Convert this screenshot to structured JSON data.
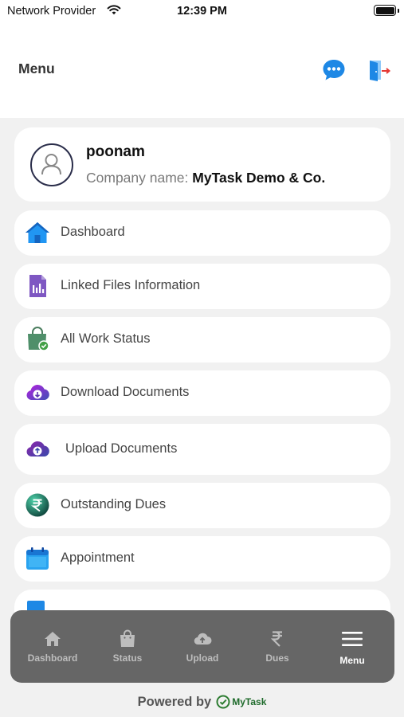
{
  "status_bar": {
    "carrier": "Network Provider",
    "time": "12:39 PM"
  },
  "header": {
    "title": "Menu",
    "chat_icon": "chat-bubble-icon",
    "logout_icon": "logout-door-icon"
  },
  "profile": {
    "name": "poonam",
    "company_label": "Company name:",
    "company_value": "MyTask Demo & Co."
  },
  "menu": {
    "items": [
      {
        "label": "Dashboard",
        "icon": "home-icon"
      },
      {
        "label": "Linked Files Information",
        "icon": "file-chart-icon"
      },
      {
        "label": "All Work Status",
        "icon": "bag-check-icon"
      },
      {
        "label": "Download Documents",
        "icon": "cloud-download-icon"
      },
      {
        "label": "Upload Documents",
        "icon": "cloud-upload-icon"
      },
      {
        "label": "Outstanding Dues",
        "icon": "rupee-coin-icon"
      },
      {
        "label": "Appointment",
        "icon": "calendar-icon"
      }
    ]
  },
  "bottom_nav": {
    "items": [
      {
        "label": "Dashboard",
        "icon": "home-icon"
      },
      {
        "label": "Status",
        "icon": "bag-icon"
      },
      {
        "label": "Upload",
        "icon": "cloud-upload-icon"
      },
      {
        "label": "Dues",
        "icon": "rupee-icon"
      },
      {
        "label": "Menu",
        "icon": "hamburger-icon",
        "active": true
      }
    ]
  },
  "footer": {
    "powered_by": "Powered by",
    "logo_text": "MyTask"
  },
  "colors": {
    "accent_blue": "#1e88e5",
    "nav_background": "#666666",
    "page_background": "#f1f1f1"
  }
}
